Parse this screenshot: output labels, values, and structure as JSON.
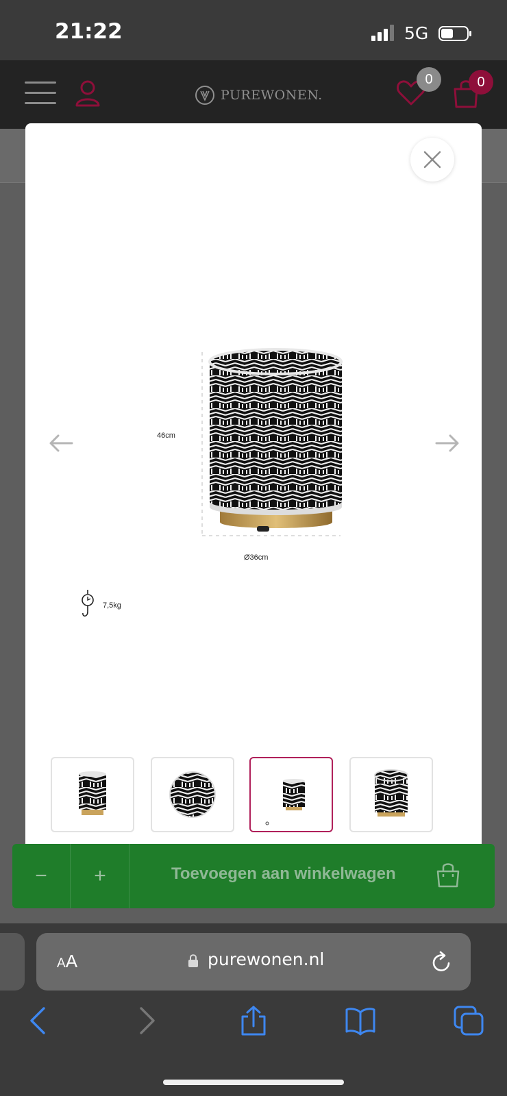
{
  "status": {
    "time": "21:22",
    "network": "5G"
  },
  "header": {
    "logo": "PUREWONEN.",
    "wishlist_count": "0",
    "cart_count": "0"
  },
  "modal": {
    "dimensions": {
      "height": "46cm",
      "diameter": "Ø36cm",
      "weight": "7,5kg"
    },
    "thumbnails_count": 4,
    "active_thumbnail": 3
  },
  "cart_bar": {
    "minus": "−",
    "plus": "+",
    "add_label": "Toevoegen aan winkelwagen"
  },
  "browser": {
    "aa_small": "A",
    "aa_large": "A",
    "url": "purewonen.nl"
  },
  "colors": {
    "brand": "#8e0f3a",
    "cart_green": "#1f7d2a",
    "ios_blue": "#3e87f0"
  }
}
